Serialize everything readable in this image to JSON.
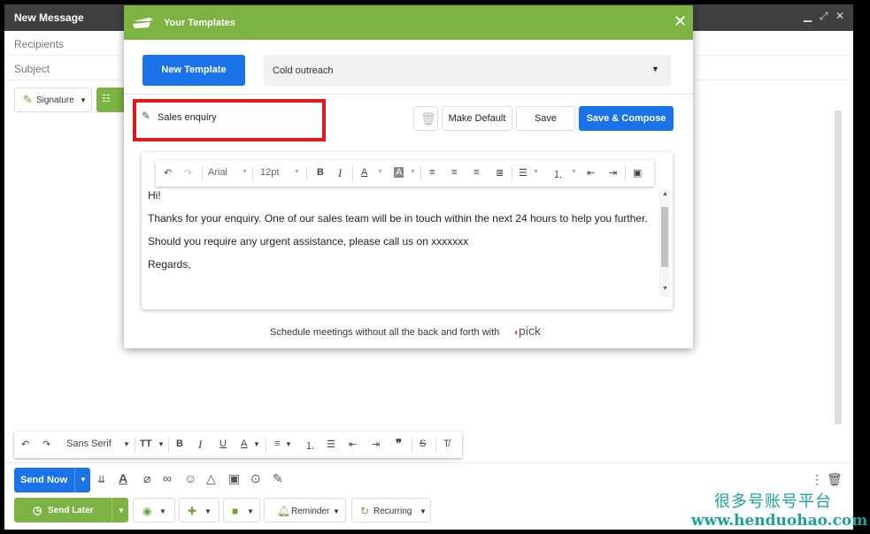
{
  "compose": {
    "title": "New Message",
    "recipients_placeholder": "Recipients",
    "subject_placeholder": "Subject",
    "signature_label": "Signature",
    "header_icons": [
      "minimize-icon",
      "expand-icon",
      "close-icon"
    ]
  },
  "format_toolbar": {
    "font": "Sans Serif",
    "icons": [
      "undo-icon",
      "redo-icon",
      "font-size-icon",
      "bold-icon",
      "italic-icon",
      "underline-icon",
      "text-color-icon",
      "align-icon",
      "numbered-list-icon",
      "bulleted-list-icon",
      "indent-less-icon",
      "indent-more-icon",
      "quote-icon",
      "strikethrough-icon",
      "remove-formatting-icon"
    ]
  },
  "send_bar": {
    "send_now_label": "Send Now",
    "send_later_label": "Send Later",
    "reminder_label": "Reminder",
    "recurring_label": "Recurring",
    "icons": [
      "templates-icon",
      "formatting-icon",
      "attach-icon",
      "link-icon",
      "emoji-icon",
      "drive-icon",
      "photo-icon",
      "lock-icon",
      "pen-icon",
      "more-icon",
      "trash-icon"
    ]
  },
  "templates_modal": {
    "title": "Your Templates",
    "new_template_label": "New Template",
    "selected_template": "Cold outreach",
    "template_name": "Sales enquiry",
    "make_default_label": "Make Default",
    "save_label": "Save",
    "save_compose_label": "Save & Compose",
    "editor_font": "Arial",
    "editor_size": "12pt",
    "body": [
      "Hi!",
      "Thanks for your enquiry. One of our sales team will be in touch within the next 24 hours to help you further.",
      "Should you require any urgent assistance, please call us on xxxxxxx",
      "Regards,"
    ],
    "footer_text": "Schedule meetings without all the back and forth with",
    "footer_brand": "pick"
  },
  "watermark": {
    "cn": "很多号账号平台",
    "url": "www.henduohao.com"
  },
  "colors": {
    "green": "#7cb342",
    "blue": "#1a73e8",
    "highlight_red": "#e3161b",
    "header_dark": "#404040",
    "watermark": "#1aa39a"
  }
}
